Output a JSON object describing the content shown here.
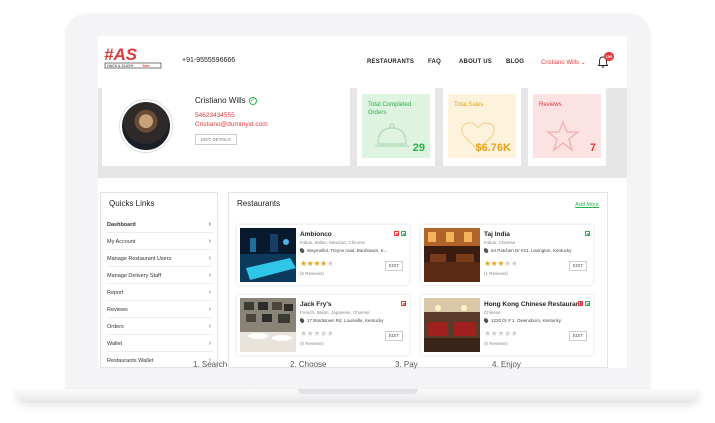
{
  "colors": {
    "brand": "#e0393e",
    "green": "#2ab04a",
    "star": "#e8a317"
  },
  "header": {
    "logo_alt": "HAS HACK & SLASH",
    "phone": "+91-9555596666",
    "nav": [
      "RESTAURANTS",
      "FAQ",
      "ABOUT US",
      "BLOG"
    ],
    "user": "Cristiano Wills",
    "notification_count": "150",
    "icons": [
      "bell-icon",
      "chevron-down-icon"
    ]
  },
  "profile": {
    "name": "Cristiano Wills",
    "phone": "54623434555",
    "email": "Cristiano@dummyid.com",
    "edit_label": "EDIT DETAILS"
  },
  "stats": [
    {
      "label": "Total Completed Orders",
      "value": "29",
      "color": "#2ab04a",
      "bg": "#dff3e1",
      "icon": "cloche-icon"
    },
    {
      "label": "Total Sales",
      "value": "$6.76K",
      "color": "#e8a317",
      "bg": "#fdf3dc",
      "icon": "heart-icon"
    },
    {
      "label": "Reviews",
      "value": "7",
      "color": "#e0393e",
      "bg": "#fbe3e4",
      "icon": "star-icon"
    }
  ],
  "quick_links": {
    "title": "Quicks Links",
    "items": [
      "Dashboard",
      "My Account",
      "Manage Restaurant Users",
      "Manage Delivery Staff",
      "Report",
      "Reviews",
      "Orders",
      "Wallet",
      "Restaurants Wallet"
    ]
  },
  "restaurants": {
    "title": "Restaurants",
    "add_more": "Add More",
    "edit_label": "EDIT",
    "items": [
      {
        "name": "Ambionco",
        "cuisine": "Indian, Italian, Mexican, Chinese",
        "address": "Waymellot, Treyne road, Bardstown, K...",
        "rating": 4,
        "reviews": "(6 Reviews)",
        "nonveg": true,
        "veg": true
      },
      {
        "name": "Taj India",
        "cuisine": "Indian, Chinese",
        "address": "54 Patchen Dr #21, Lexington, Kentucky",
        "rating": 3,
        "reviews": "(1 Reviews)",
        "nonveg": false,
        "veg": true
      },
      {
        "name": "Jack Fry's",
        "cuisine": "French, Italian, Japanese, Chinese",
        "address": "17 Bardstown Rd, Louisville, Kentucky",
        "rating": 0,
        "reviews": "(0 Reviews)",
        "nonveg": true,
        "veg": false
      },
      {
        "name": "Hong Kong Chinese Restaurant",
        "cuisine": "Chinese",
        "address": "1220 Dr # 1, Owensboro, Kentucky",
        "rating": 0,
        "reviews": "(0 Reviews)",
        "nonveg": true,
        "veg": true
      }
    ]
  },
  "steps": [
    "1. Search",
    "2. Choose",
    "3. Pay",
    "4. Enjoy"
  ]
}
